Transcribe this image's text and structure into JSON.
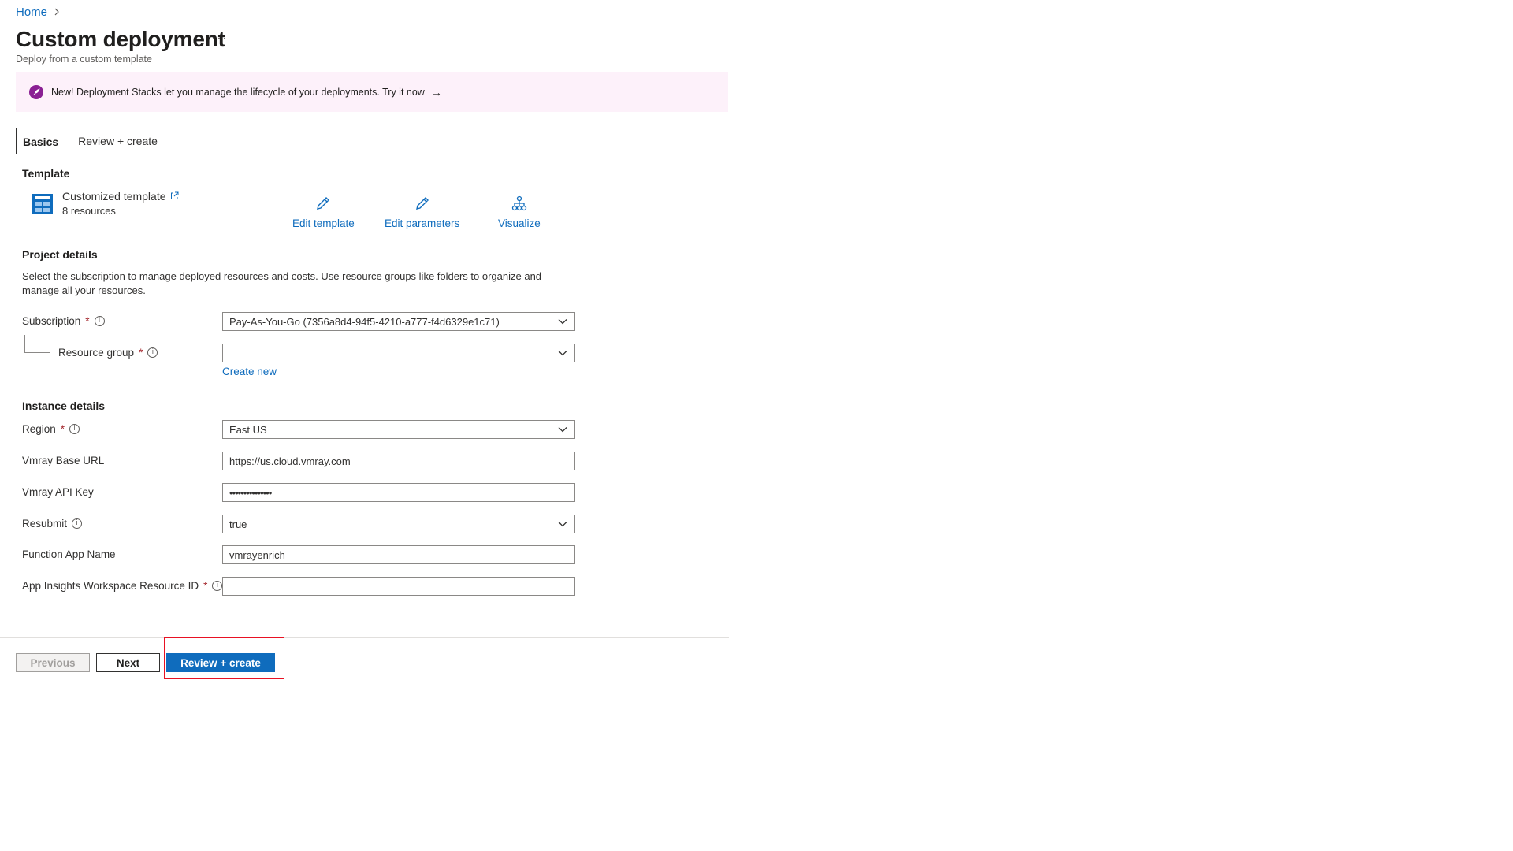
{
  "breadcrumb": {
    "home": "Home"
  },
  "header": {
    "title": "Custom deployment",
    "ellipsis": "···",
    "subtitle": "Deploy from a custom template"
  },
  "banner": {
    "text": "New! Deployment Stacks let you manage the lifecycle of your deployments. Try it now",
    "arrow": "→",
    "accent_color": "#8a1f93",
    "background": "#fdf1fa"
  },
  "tabs": [
    {
      "label": "Basics",
      "active": true
    },
    {
      "label": "Review + create",
      "active": false
    }
  ],
  "template": {
    "heading": "Template",
    "link_label": "Customized template",
    "resources": "8 resources",
    "actions": {
      "edit_template": "Edit template",
      "edit_parameters": "Edit parameters",
      "visualize": "Visualize"
    }
  },
  "project": {
    "heading": "Project details",
    "description": "Select the subscription to manage deployed resources and costs. Use resource groups like folders to organize and manage all your resources.",
    "subscription_label": "Subscription",
    "subscription_value": "Pay-As-You-Go (7356a8d4-94f5-4210-a777-f4d6329e1c71)",
    "resource_group_label": "Resource group",
    "resource_group_value": "",
    "create_new": "Create new"
  },
  "instance": {
    "heading": "Instance details",
    "region_label": "Region",
    "region_value": "East US",
    "base_url_label": "Vmray Base URL",
    "base_url_value": "https://us.cloud.vmray.com",
    "api_key_label": "Vmray API Key",
    "api_key_value": "•••••••••••••••",
    "resubmit_label": "Resubmit",
    "resubmit_value": "true",
    "function_app_label": "Function App Name",
    "function_app_value": "vmrayenrich",
    "app_insights_label": "App Insights Workspace Resource ID",
    "app_insights_value": ""
  },
  "required_marker": "*",
  "info_glyph": "i",
  "footer": {
    "previous": "Previous",
    "next": "Next",
    "review_create": "Review + create"
  },
  "colors": {
    "link": "#0f6cbd",
    "primary_button": "#0f6cbd",
    "required": "#a4262c",
    "highlight_border": "#e81123"
  }
}
